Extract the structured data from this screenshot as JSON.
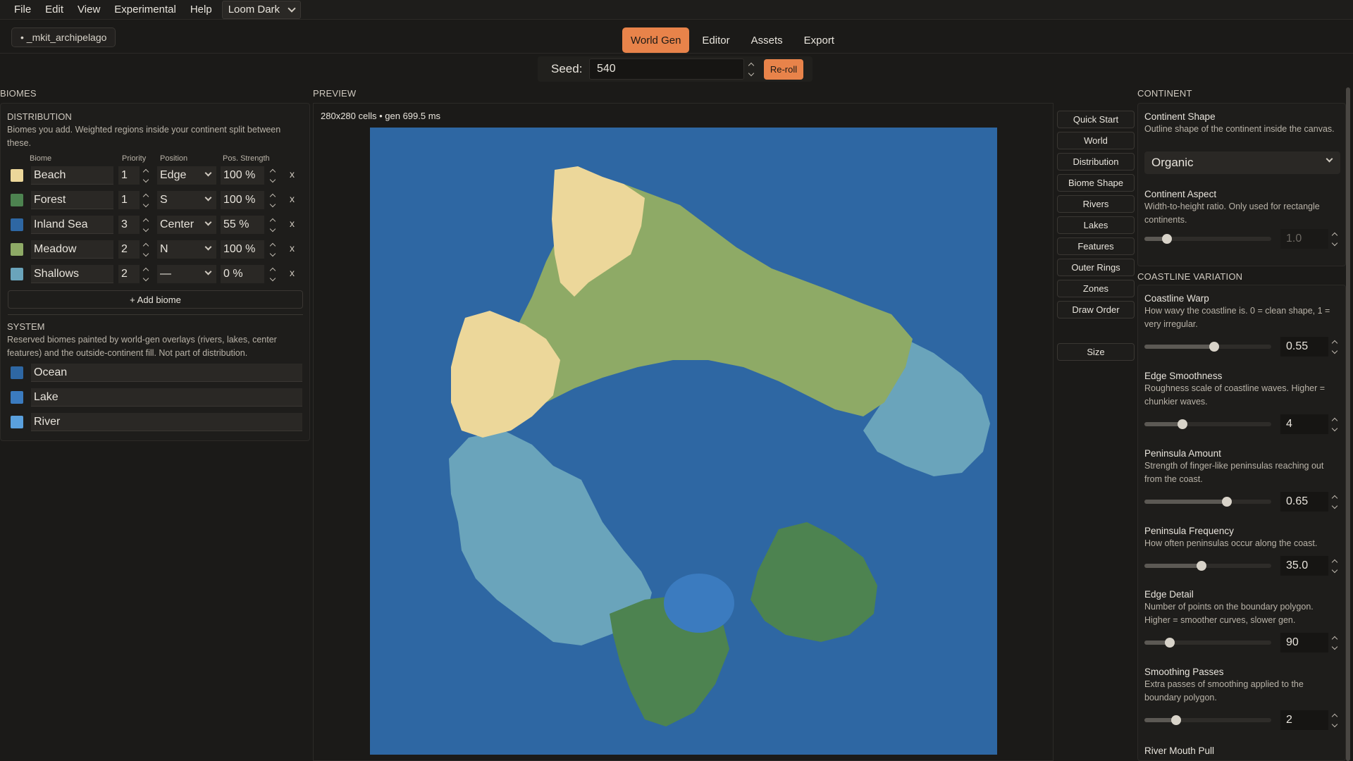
{
  "menu": {
    "items": [
      "File",
      "Edit",
      "View",
      "Experimental",
      "Help"
    ],
    "theme": "Loom Dark"
  },
  "project": {
    "name": "• _mkit_archipelago"
  },
  "tabs": [
    "World Gen",
    "Editor",
    "Assets",
    "Export"
  ],
  "active_tab": "World Gen",
  "seed": {
    "label": "Seed:",
    "value": "540",
    "reroll_label": "Re-roll"
  },
  "biomes": {
    "header": "BIOMES",
    "distribution": {
      "header": "DISTRIBUTION",
      "description": "Biomes you add. Weighted regions inside your continent split between these.",
      "columns": [
        "Biome",
        "Priority",
        "Position",
        "Pos. Strength"
      ],
      "rows": [
        {
          "name": "Beach",
          "color": "#ecd79a",
          "priority": "1",
          "position": "Edge",
          "strength": "100 %"
        },
        {
          "name": "Forest",
          "color": "#4d8350",
          "priority": "1",
          "position": "S",
          "strength": "100 %"
        },
        {
          "name": "Inland Sea",
          "color": "#2e67a3",
          "priority": "3",
          "position": "Center",
          "strength": "55 %"
        },
        {
          "name": "Meadow",
          "color": "#8eaa66",
          "priority": "2",
          "position": "N",
          "strength": "100 %"
        },
        {
          "name": "Shallows",
          "color": "#6aa4bb",
          "priority": "2",
          "position": "—",
          "strength": "0 %"
        }
      ],
      "remove_label": "x",
      "add_label": "+ Add biome"
    },
    "system": {
      "header": "SYSTEM",
      "description": "Reserved biomes painted by world-gen overlays (rivers, lakes, center features) and the outside-continent fill. Not part of distribution.",
      "rows": [
        {
          "name": "Ocean",
          "color": "#2e67a3"
        },
        {
          "name": "Lake",
          "color": "#3b7bbf"
        },
        {
          "name": "River",
          "color": "#5aa0dd"
        }
      ]
    }
  },
  "preview": {
    "header": "PREVIEW",
    "info": "280x280 cells • gen 699.5 ms",
    "colors": {
      "ocean": "#2e67a3",
      "beach": "#ecd79a",
      "meadow": "#8eaa66",
      "shallows": "#6aa4bb",
      "forest": "#4d8350",
      "lake": "#3b7bbf"
    }
  },
  "side_nav": [
    "Quick Start",
    "World",
    "Distribution",
    "Biome Shape",
    "Rivers",
    "Lakes",
    "Features",
    "Outer Rings",
    "Zones",
    "Draw Order"
  ],
  "side_size": "Size",
  "continent": {
    "header": "CONTINENT",
    "shape": {
      "title": "Continent Shape",
      "desc": "Outline shape of the continent inside the canvas.",
      "value": "Organic"
    },
    "aspect": {
      "title": "Continent Aspect",
      "desc": "Width-to-height ratio. Only used for rectangle continents.",
      "value": "1.0",
      "fraction": 0.18
    }
  },
  "coastline": {
    "header": "COASTLINE VARIATION",
    "controls": [
      {
        "title": "Coastline Warp",
        "desc": "How wavy the coastline is. 0 = clean shape, 1 = very irregular.",
        "value": "0.55",
        "fraction": 0.55
      },
      {
        "title": "Edge Smoothness",
        "desc": "Roughness scale of coastline waves. Higher = chunkier waves.",
        "value": "4",
        "fraction": 0.3
      },
      {
        "title": "Peninsula Amount",
        "desc": "Strength of finger-like peninsulas reaching out from the coast.",
        "value": "0.65",
        "fraction": 0.65
      },
      {
        "title": "Peninsula Frequency",
        "desc": "How often peninsulas occur along the coast.",
        "value": "35.0",
        "fraction": 0.45
      },
      {
        "title": "Edge Detail",
        "desc": "Number of points on the boundary polygon. Higher = smoother curves, slower gen.",
        "value": "90",
        "fraction": 0.2
      },
      {
        "title": "Smoothing Passes",
        "desc": "Extra passes of smoothing applied to the boundary polygon.",
        "value": "2",
        "fraction": 0.25
      }
    ],
    "next_title": "River Mouth Pull"
  }
}
